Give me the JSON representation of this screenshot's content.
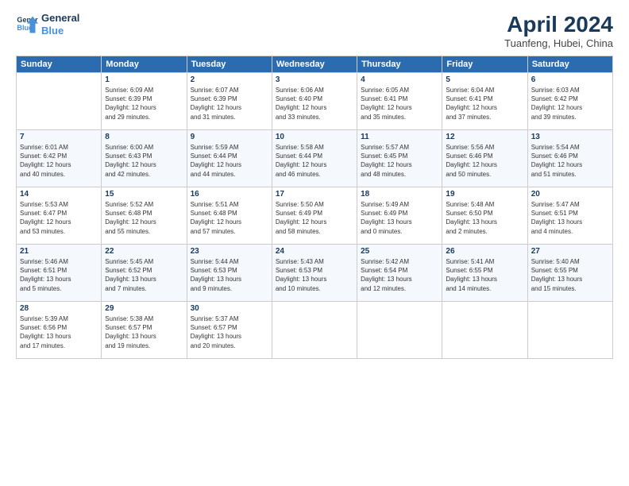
{
  "logo": {
    "line1": "General",
    "line2": "Blue"
  },
  "title": "April 2024",
  "subtitle": "Tuanfeng, Hubei, China",
  "days_of_week": [
    "Sunday",
    "Monday",
    "Tuesday",
    "Wednesday",
    "Thursday",
    "Friday",
    "Saturday"
  ],
  "weeks": [
    [
      {
        "day": "",
        "info": ""
      },
      {
        "day": "1",
        "info": "Sunrise: 6:09 AM\nSunset: 6:39 PM\nDaylight: 12 hours\nand 29 minutes."
      },
      {
        "day": "2",
        "info": "Sunrise: 6:07 AM\nSunset: 6:39 PM\nDaylight: 12 hours\nand 31 minutes."
      },
      {
        "day": "3",
        "info": "Sunrise: 6:06 AM\nSunset: 6:40 PM\nDaylight: 12 hours\nand 33 minutes."
      },
      {
        "day": "4",
        "info": "Sunrise: 6:05 AM\nSunset: 6:41 PM\nDaylight: 12 hours\nand 35 minutes."
      },
      {
        "day": "5",
        "info": "Sunrise: 6:04 AM\nSunset: 6:41 PM\nDaylight: 12 hours\nand 37 minutes."
      },
      {
        "day": "6",
        "info": "Sunrise: 6:03 AM\nSunset: 6:42 PM\nDaylight: 12 hours\nand 39 minutes."
      }
    ],
    [
      {
        "day": "7",
        "info": "Sunrise: 6:01 AM\nSunset: 6:42 PM\nDaylight: 12 hours\nand 40 minutes."
      },
      {
        "day": "8",
        "info": "Sunrise: 6:00 AM\nSunset: 6:43 PM\nDaylight: 12 hours\nand 42 minutes."
      },
      {
        "day": "9",
        "info": "Sunrise: 5:59 AM\nSunset: 6:44 PM\nDaylight: 12 hours\nand 44 minutes."
      },
      {
        "day": "10",
        "info": "Sunrise: 5:58 AM\nSunset: 6:44 PM\nDaylight: 12 hours\nand 46 minutes."
      },
      {
        "day": "11",
        "info": "Sunrise: 5:57 AM\nSunset: 6:45 PM\nDaylight: 12 hours\nand 48 minutes."
      },
      {
        "day": "12",
        "info": "Sunrise: 5:56 AM\nSunset: 6:46 PM\nDaylight: 12 hours\nand 50 minutes."
      },
      {
        "day": "13",
        "info": "Sunrise: 5:54 AM\nSunset: 6:46 PM\nDaylight: 12 hours\nand 51 minutes."
      }
    ],
    [
      {
        "day": "14",
        "info": "Sunrise: 5:53 AM\nSunset: 6:47 PM\nDaylight: 12 hours\nand 53 minutes."
      },
      {
        "day": "15",
        "info": "Sunrise: 5:52 AM\nSunset: 6:48 PM\nDaylight: 12 hours\nand 55 minutes."
      },
      {
        "day": "16",
        "info": "Sunrise: 5:51 AM\nSunset: 6:48 PM\nDaylight: 12 hours\nand 57 minutes."
      },
      {
        "day": "17",
        "info": "Sunrise: 5:50 AM\nSunset: 6:49 PM\nDaylight: 12 hours\nand 58 minutes."
      },
      {
        "day": "18",
        "info": "Sunrise: 5:49 AM\nSunset: 6:49 PM\nDaylight: 13 hours\nand 0 minutes."
      },
      {
        "day": "19",
        "info": "Sunrise: 5:48 AM\nSunset: 6:50 PM\nDaylight: 13 hours\nand 2 minutes."
      },
      {
        "day": "20",
        "info": "Sunrise: 5:47 AM\nSunset: 6:51 PM\nDaylight: 13 hours\nand 4 minutes."
      }
    ],
    [
      {
        "day": "21",
        "info": "Sunrise: 5:46 AM\nSunset: 6:51 PM\nDaylight: 13 hours\nand 5 minutes."
      },
      {
        "day": "22",
        "info": "Sunrise: 5:45 AM\nSunset: 6:52 PM\nDaylight: 13 hours\nand 7 minutes."
      },
      {
        "day": "23",
        "info": "Sunrise: 5:44 AM\nSunset: 6:53 PM\nDaylight: 13 hours\nand 9 minutes."
      },
      {
        "day": "24",
        "info": "Sunrise: 5:43 AM\nSunset: 6:53 PM\nDaylight: 13 hours\nand 10 minutes."
      },
      {
        "day": "25",
        "info": "Sunrise: 5:42 AM\nSunset: 6:54 PM\nDaylight: 13 hours\nand 12 minutes."
      },
      {
        "day": "26",
        "info": "Sunrise: 5:41 AM\nSunset: 6:55 PM\nDaylight: 13 hours\nand 14 minutes."
      },
      {
        "day": "27",
        "info": "Sunrise: 5:40 AM\nSunset: 6:55 PM\nDaylight: 13 hours\nand 15 minutes."
      }
    ],
    [
      {
        "day": "28",
        "info": "Sunrise: 5:39 AM\nSunset: 6:56 PM\nDaylight: 13 hours\nand 17 minutes."
      },
      {
        "day": "29",
        "info": "Sunrise: 5:38 AM\nSunset: 6:57 PM\nDaylight: 13 hours\nand 19 minutes."
      },
      {
        "day": "30",
        "info": "Sunrise: 5:37 AM\nSunset: 6:57 PM\nDaylight: 13 hours\nand 20 minutes."
      },
      {
        "day": "",
        "info": ""
      },
      {
        "day": "",
        "info": ""
      },
      {
        "day": "",
        "info": ""
      },
      {
        "day": "",
        "info": ""
      }
    ]
  ]
}
